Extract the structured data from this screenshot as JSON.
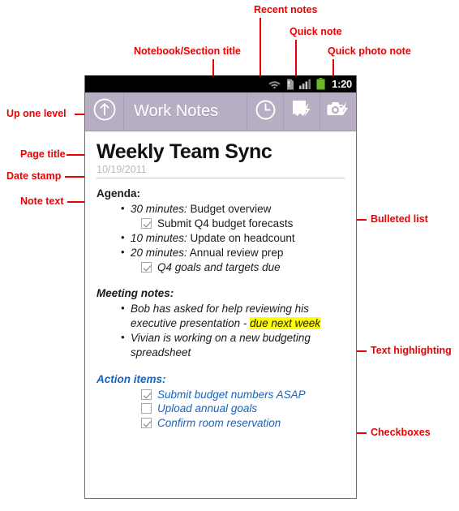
{
  "colors": {
    "annotation": "#ee0000",
    "actionbar": "#b8aec4",
    "statusbar": "#000000",
    "highlight": "#ffff00",
    "action_items_blue": "#1565c0",
    "date_gray": "#b9b9b9"
  },
  "status_bar": {
    "clock": "1:20",
    "icons": [
      "wifi-icon",
      "sd-card-warning-icon",
      "signal-bars-icon",
      "battery-icon"
    ]
  },
  "action_bar": {
    "up_icon": "up-arrow-circle-icon",
    "title": "Work Notes",
    "buttons": [
      {
        "icon": "clock-icon",
        "name": "recent-notes-button"
      },
      {
        "icon": "quick-note-icon",
        "name": "quick-note-button"
      },
      {
        "icon": "camera-flash-icon",
        "name": "quick-photo-note-button"
      }
    ]
  },
  "note": {
    "title": "Weekly Team Sync",
    "date": "10/19/2011",
    "agenda": {
      "heading": "Agenda:",
      "items": [
        {
          "type": "bullet",
          "lead": "30 minutes:",
          "text": " Budget overview"
        },
        {
          "type": "checkbox",
          "checked": true,
          "text": "Submit Q4 budget forecasts",
          "italic": false
        },
        {
          "type": "bullet",
          "lead": "10 minutes:",
          "text": " Update on headcount"
        },
        {
          "type": "bullet",
          "lead": "20 minutes:",
          "text": " Annual review prep"
        },
        {
          "type": "checkbox",
          "checked": true,
          "text": "Q4 goals and targets due",
          "italic": true
        }
      ]
    },
    "meeting_notes": {
      "heading": "Meeting notes:",
      "items": [
        {
          "before": "Bob has asked for help reviewing his executive presentation - ",
          "highlight": "due next week",
          "after": ""
        },
        {
          "before": "Vivian is working on a new budgeting spreadsheet",
          "highlight": "",
          "after": ""
        }
      ]
    },
    "action_items": {
      "heading": "Action items:",
      "items": [
        {
          "checked": true,
          "text": "Submit budget numbers ASAP"
        },
        {
          "checked": false,
          "text": "Upload annual goals"
        },
        {
          "checked": true,
          "text": "Confirm room reservation"
        }
      ]
    }
  },
  "annotations": {
    "recent_notes": "Recent notes",
    "quick_note": "Quick note",
    "quick_photo_note": "Quick photo note",
    "notebook_section_title": "Notebook/Section title",
    "up_one_level": "Up one level",
    "page_title": "Page title",
    "date_stamp": "Date stamp",
    "note_text": "Note text",
    "bulleted_list": "Bulleted list",
    "text_highlighting": "Text highlighting",
    "checkboxes": "Checkboxes"
  }
}
